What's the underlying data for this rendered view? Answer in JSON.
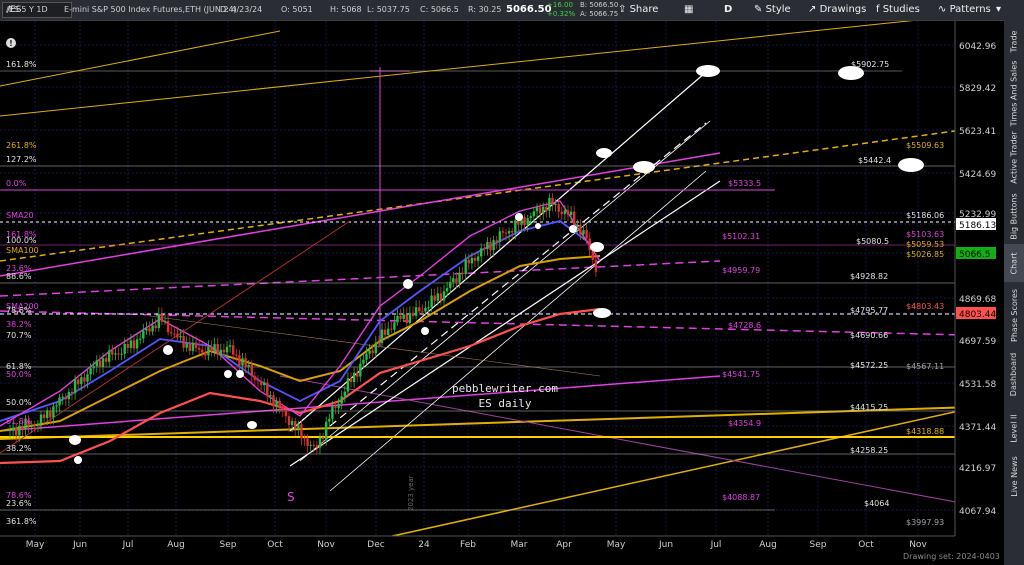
{
  "toolbar": {
    "symbol": "/ES",
    "symbol_info": "/ES 5 Y 1D",
    "description": "E-mini S&P 500 Index Futures,ETH (JUN 24)",
    "date": "D: 4/23/24",
    "open": "O: 5051",
    "high": "H: 5068",
    "low": "L: 5037.75",
    "close": "C: 5066.5",
    "range": "R: 30.25",
    "last_price": "5066.50",
    "net_change": "+16.00",
    "pct_change": "+0.32%",
    "bid": "B: 5066.50",
    "ask": "A: 5066.75",
    "sma10_label": "SimpleMovingAvg (CLOSE, 10, 0, no)",
    "sma10_value": "5103.75",
    "sma20_label": "SimpleMovingAvg (CLOSE, 20, 0, no)",
    "sma20_value": "5186.13",
    "sma50_label": "SimpleMovingAvg (CLOSE, 50, 0, no)",
    "sma50_value": "5180.37",
    "sma_more": "SimpleMoving...",
    "share": "Share",
    "period": "D",
    "style": "Style",
    "drawings": "Drawings",
    "studies": "Studies",
    "patterns": "Patterns"
  },
  "sidebar": {
    "tabs": [
      "Trade",
      "Times And Sales",
      "Active Trader",
      "Big Buttons",
      "Chart",
      "Phase Scores",
      "Dashboard",
      "Level II",
      "Live News"
    ],
    "active": "Chart"
  },
  "price_axis": {
    "labels": [
      "6042.96",
      "5829.42",
      "5623.41",
      "5424.69",
      "5232.99",
      "5186.13",
      "5066.5",
      "4869.68",
      "4803.44",
      "4697.59",
      "4531.58",
      "4371.44",
      "4216.97",
      "4067.94"
    ]
  },
  "time_axis": {
    "labels": [
      "May",
      "Jun",
      "Jul",
      "Aug",
      "Sep",
      "Oct",
      "Nov",
      "Dec",
      "24",
      "Feb",
      "Mar",
      "Apr",
      "May",
      "Jun",
      "Jul",
      "Aug",
      "Sep",
      "Oct",
      "Nov"
    ]
  },
  "fib_labels": [
    "161.8%",
    "261.8%",
    "127.2%",
    "0.0%",
    "SMA20",
    "161.8%",
    "100.0%",
    "SMA100",
    "23.6%",
    "88.6%",
    "SMA200",
    "78.6%",
    "38.2%",
    "70.7%",
    "61.8%",
    "50.0%",
    "50.0%",
    "61.8%",
    "38.2%",
    "78.6%",
    "23.6%",
    "361.8%"
  ],
  "level_labels": [
    "$5902.75",
    "$5509.63",
    "$5442.4",
    "$5333.5",
    "$5186.06",
    "$5103.63",
    "$5102.31",
    "$5080.5",
    "$5059.53",
    "$5026.85",
    "$4959.79",
    "$4928.82",
    "$4803.43",
    "$4795.77",
    "$4728.6",
    "$4690.66",
    "$4567.11",
    "$4572.25",
    "$4541.75",
    "$4415.25",
    "$4354.9",
    "$4318.88",
    "$4258.25",
    "$4088.87",
    "$4064",
    "$3997.93"
  ],
  "watermark": {
    "line1": "pebblewriter.com",
    "line2": "ES daily"
  },
  "marker_s": "S",
  "year_label": "2023 year",
  "status": "Drawing set: 2024-0403",
  "colors": {
    "magenta": "#e040e0",
    "yellow": "#e0b000",
    "white": "#ffffff",
    "navy_grid": "#1a1a4a",
    "salmon": "#ff6666",
    "blue_ma": "#5555ff",
    "green_last": "#10b010"
  }
}
